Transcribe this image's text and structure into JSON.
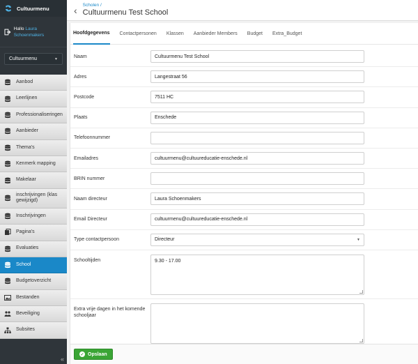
{
  "brand": {
    "name": "Cultuurmenu"
  },
  "user": {
    "greeting": "Hallo",
    "name": "Laura Schoenmakers"
  },
  "org_select": {
    "value": "Cultuurmenu"
  },
  "nav": [
    {
      "label": "Aanbod",
      "icon": "database-icon"
    },
    {
      "label": "Leerlijnen",
      "icon": "database-icon"
    },
    {
      "label": "Professionaliseringen",
      "icon": "database-icon"
    },
    {
      "label": "Aanbieder",
      "icon": "database-icon"
    },
    {
      "label": "Thema's",
      "icon": "database-icon"
    },
    {
      "label": "Kenmerk mapping",
      "icon": "database-icon"
    },
    {
      "label": "Makelaar",
      "icon": "database-icon"
    },
    {
      "label": "inschrijvingen (klas gewijzigd)",
      "icon": "database-icon"
    },
    {
      "label": "Inschrijvingen",
      "icon": "database-icon"
    },
    {
      "label": "Pagina's",
      "icon": "pages-icon"
    },
    {
      "label": "Evaluaties",
      "icon": "database-icon"
    },
    {
      "label": "School",
      "icon": "database-icon"
    },
    {
      "label": "Budgetoverzicht",
      "icon": "database-icon"
    },
    {
      "label": "Bestanden",
      "icon": "image-icon"
    },
    {
      "label": "Beveiliging",
      "icon": "users-icon"
    },
    {
      "label": "Subsites",
      "icon": "sitemap-icon"
    }
  ],
  "active_nav": "School",
  "collapse_label": "«",
  "header": {
    "breadcrumb": "Scholen /",
    "title": "Cultuurmenu Test School"
  },
  "tabs": [
    "Hoofdgegevens",
    "Contactpersonen",
    "Klassen",
    "Aanbieder Members",
    "Budget",
    "Extra_Budget"
  ],
  "form": {
    "naam": {
      "label": "Naam",
      "value": "Cultuurmenu Test School"
    },
    "adres": {
      "label": "Adres",
      "value": "Langestraat 56"
    },
    "postcode": {
      "label": "Postcode",
      "value": "7511 HC"
    },
    "plaats": {
      "label": "Plaats",
      "value": "Enschede"
    },
    "telefoon": {
      "label": "Telefoonnummer",
      "value": ""
    },
    "email": {
      "label": "Emailadres",
      "value": "cultuurmenu@cultuureducatie-enschede.nl"
    },
    "brin": {
      "label": "BRIN nummer",
      "value": ""
    },
    "directeur": {
      "label": "Naam directeur",
      "value": "Laura Schoenmakers"
    },
    "email_dir": {
      "label": "Email Directeur",
      "value": "cultuurmenu@cultuureducatie-enschede.nl"
    },
    "type_contact": {
      "label": "Type contactpersoon",
      "value": "Directeur"
    },
    "schooltijden": {
      "label": "Schooltijden",
      "value": "9.30 - 17.00"
    },
    "extra_dagen": {
      "label": "Extra vrije dagen in het komende schooljaar",
      "value": ""
    }
  },
  "save_label": "Opslaan",
  "colors": {
    "accent": "#1a88c8",
    "save": "#3aa535",
    "sidebar": "#2f353a"
  }
}
